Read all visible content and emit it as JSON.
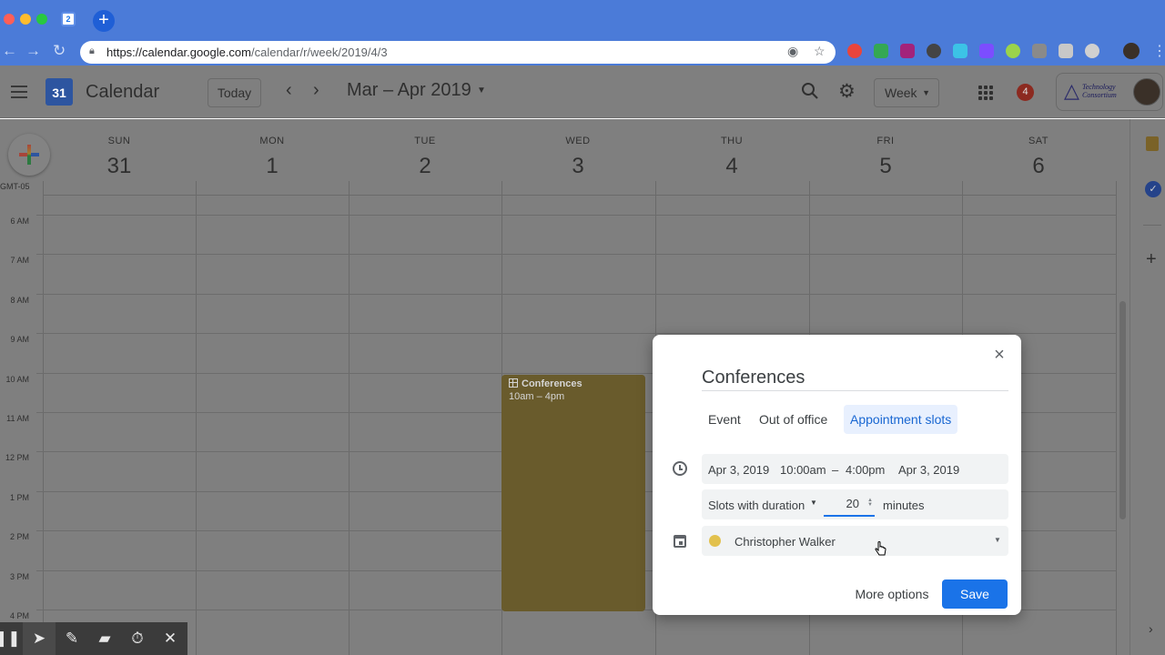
{
  "browser": {
    "tab_badge": "2",
    "url_host": "https://calendar.google.com",
    "url_path": "/calendar/r/week/2019/4/3",
    "extension_colors": [
      "#e8453c",
      "#34a853",
      "#a3237b",
      "#444444",
      "#3cc3e6",
      "#7c4dff",
      "#9bd34b",
      "#8a8a8a",
      "#c8c8c8",
      "#d0d0d0"
    ]
  },
  "header": {
    "app_title": "Calendar",
    "logo_day": "31",
    "today_label": "Today",
    "date_range": "Mar – Apr 2019",
    "view_label": "Week",
    "notification_count": "4",
    "org_name_line1": "Technology",
    "org_name_line2": "Consortium"
  },
  "week": {
    "timezone": "GMT-05",
    "days": [
      {
        "dow": "SUN",
        "num": "31"
      },
      {
        "dow": "MON",
        "num": "1"
      },
      {
        "dow": "TUE",
        "num": "2"
      },
      {
        "dow": "WED",
        "num": "3"
      },
      {
        "dow": "THU",
        "num": "4"
      },
      {
        "dow": "FRI",
        "num": "5"
      },
      {
        "dow": "SAT",
        "num": "6"
      }
    ],
    "hours": [
      "6 AM",
      "7 AM",
      "8 AM",
      "9 AM",
      "10 AM",
      "11 AM",
      "12 PM",
      "1 PM",
      "2 PM",
      "3 PM",
      "4 PM"
    ]
  },
  "event": {
    "title": "Conferences",
    "time": "10am – 4pm",
    "color": "#e2c14d"
  },
  "dialog": {
    "title": "Conferences",
    "tabs": [
      "Event",
      "Out of office",
      "Appointment slots"
    ],
    "active_tab": "Appointment slots",
    "start_date": "Apr 3, 2019",
    "start_time": "10:00am",
    "dash": "–",
    "end_time": "4:00pm",
    "end_date": "Apr 3, 2019",
    "slot_mode": "Slots with duration",
    "slot_duration": "20",
    "slot_unit": "minutes",
    "calendar_owner": "Christopher Walker",
    "more_options_label": "More options",
    "save_label": "Save",
    "accent_color": "#1a73e8"
  },
  "recorder_toolbar": {
    "tools": [
      "pause-icon",
      "pointer-icon",
      "pencil-icon",
      "highlighter-icon",
      "timer-icon",
      "close-icon"
    ]
  }
}
